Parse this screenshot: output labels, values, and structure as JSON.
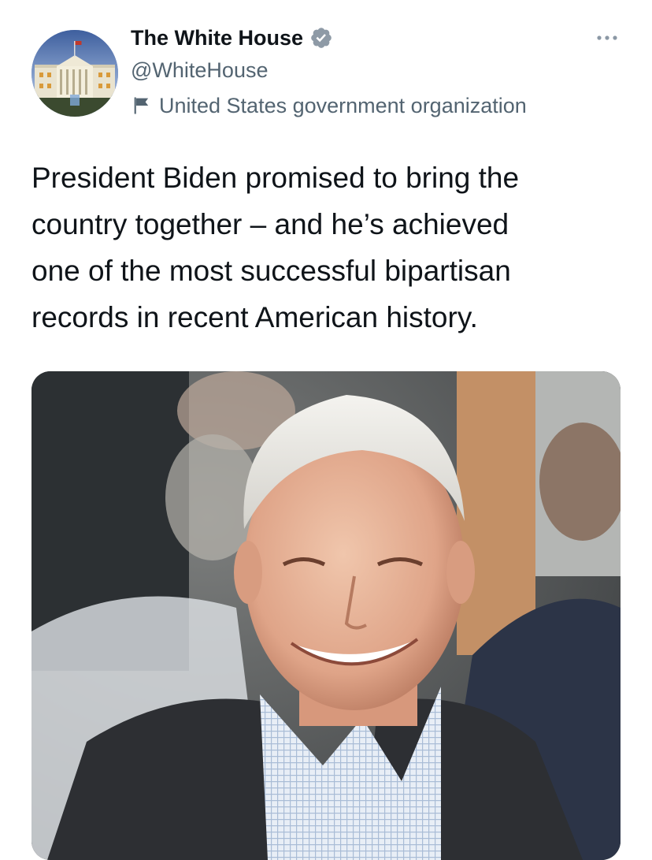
{
  "tweet": {
    "author": {
      "display_name": "The White House",
      "handle": "@WhiteHouse",
      "verified": true,
      "label": "United States government organization",
      "avatar_icon": "white-house-avatar",
      "label_icon": "flag-icon",
      "verified_icon": "verified-badge-icon"
    },
    "more_icon": "more-options-icon",
    "text_lines": [
      "President Biden promised to bring the",
      "country together – and he’s achieved",
      "one of the most successful bipartisan",
      "records in recent American history."
    ],
    "media": {
      "type": "photo",
      "icon": "photo"
    },
    "colors": {
      "verified_blue": "#1d9bf0",
      "secondary_text": "#536471",
      "primary_text": "#0f1419"
    }
  }
}
